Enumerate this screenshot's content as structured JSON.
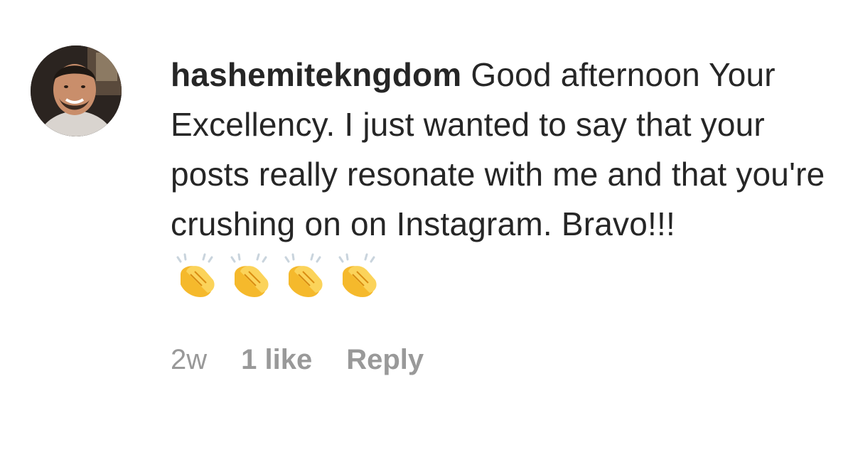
{
  "comment": {
    "username": "hashemitekngdom",
    "text": "Good afternoon Your Excellency. I just wanted to say that your posts really resonate with me and that you're crushing on on Instagram. Bravo!!!",
    "emoji": [
      "👏",
      "👏",
      "👏",
      "👏"
    ],
    "emoji_icon": "clapping-hands-icon",
    "time": "2w",
    "likes": "1 like",
    "reply_label": "Reply"
  },
  "colors": {
    "text": "#262626",
    "meta": "#999999",
    "clap_yellow": "#f7c23b"
  }
}
